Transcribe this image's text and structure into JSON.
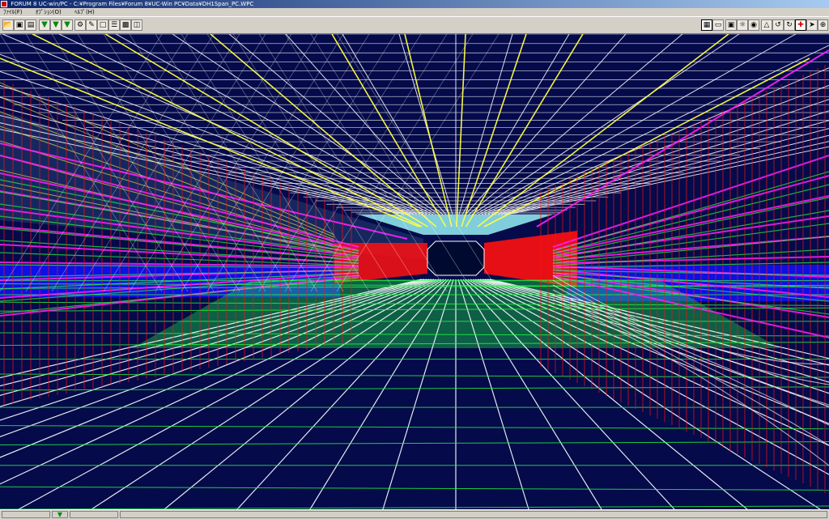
{
  "window": {
    "title": "FORUM 8   UC-win/PC    - C:¥Program Files¥Forum 8¥UC-Win PC¥Data¥DH1Span_PC.WPC"
  },
  "menu": {
    "items": [
      {
        "label": "ﾌｧｲﾙ(F)"
      },
      {
        "label": "ｵﾌﾟｼｮﾝ(O)"
      },
      {
        "label": "ﾍﾙﾌﾟ(H)"
      }
    ]
  },
  "toolbar": {
    "left": [
      "open-icon",
      "save-icon",
      "save-as-icon",
      "tub-green-icon",
      "tub-green-icon",
      "tub-green-icon",
      "model-icon",
      "paint-icon",
      "frame-icon",
      "layer-icon",
      "box-icon",
      "print-icon"
    ],
    "right": [
      "grid-icon",
      "window-icon",
      "monitor-icon",
      "light-icon",
      "camera-icon",
      "top-view-icon",
      "rotate-left-icon",
      "rotate-right-icon",
      "move-icon",
      "walk-icon",
      "zoom-icon"
    ]
  },
  "colors": {
    "background": "#040a4a",
    "white_lines": "#ffffff",
    "yellow_lines": "#ffff40",
    "green_lines": "#20ff40",
    "red_lines": "#ff1010",
    "magenta_lines": "#ff20ff",
    "cyan_fill": "#a0ffff",
    "blue_band": "#1010ff"
  }
}
